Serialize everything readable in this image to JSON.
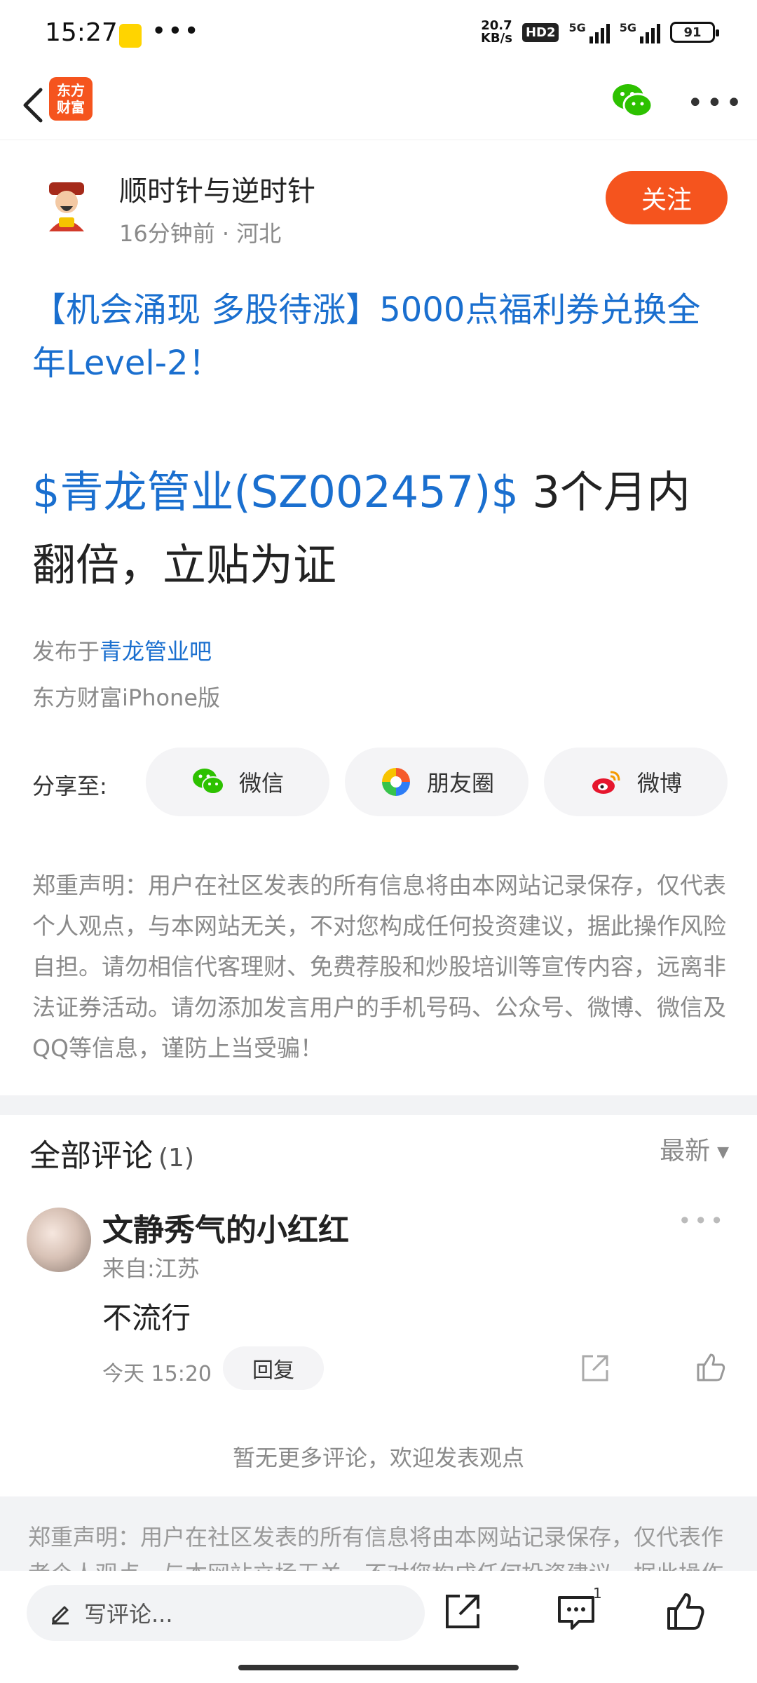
{
  "status_bar": {
    "time": "15:27",
    "dots": "•••",
    "speed_top": "20.7",
    "speed_bottom": "KB/s",
    "hd": "HD2",
    "sig1": "5G",
    "sig2": "5G",
    "battery": "91"
  },
  "nav": {
    "logo_line1": "东方",
    "logo_line2": "财富"
  },
  "author": {
    "name": "顺时针与逆时针",
    "meta": "16分钟前 · 河北",
    "follow_label": "关注"
  },
  "promo": "【机会涌现 多股待涨】5000点福利券兑换全年Level-2！",
  "post": {
    "stock_tag": "$青龙管业(SZ002457)$",
    "title_rest": " 3个月内翻倍，立贴为证",
    "posted_prefix": "发布于",
    "forum": "青龙管业吧",
    "client": "东方财富iPhone版"
  },
  "share": {
    "label": "分享至:",
    "wechat": "微信",
    "moments": "朋友圈",
    "weibo": "微博"
  },
  "disclaimer": "郑重声明：用户在社区发表的所有信息将由本网站记录保存，仅代表个人观点，与本网站无关，不对您构成任何投资建议，据此操作风险自担。请勿相信代客理财、免费荐股和炒股培训等宣传内容，远离非法证券活动。请勿添加发言用户的手机号码、公众号、微博、微信及QQ等信息，谨防上当受骗！",
  "comments": {
    "title": "全部评论",
    "count": "(1)",
    "sort": "最新",
    "items": [
      {
        "name": "文静秀气的小红红",
        "location": "来自:江苏",
        "text": "不流行",
        "time": "今天 15:20",
        "reply": "回复"
      }
    ],
    "no_more": "暂无更多评论，欢迎发表观点"
  },
  "footer_disclaimer": "郑重声明：用户在社区发表的所有信息将由本网站记录保存，仅代表作者个人观点，与本网站立场无关，不对您构成任何投资建议，据此操作风险自担。",
  "bottom_bar": {
    "placeholder": "写评论...",
    "comment_badge": "1"
  },
  "colors": {
    "accent": "#f5541e",
    "link": "#1a6fcf"
  }
}
